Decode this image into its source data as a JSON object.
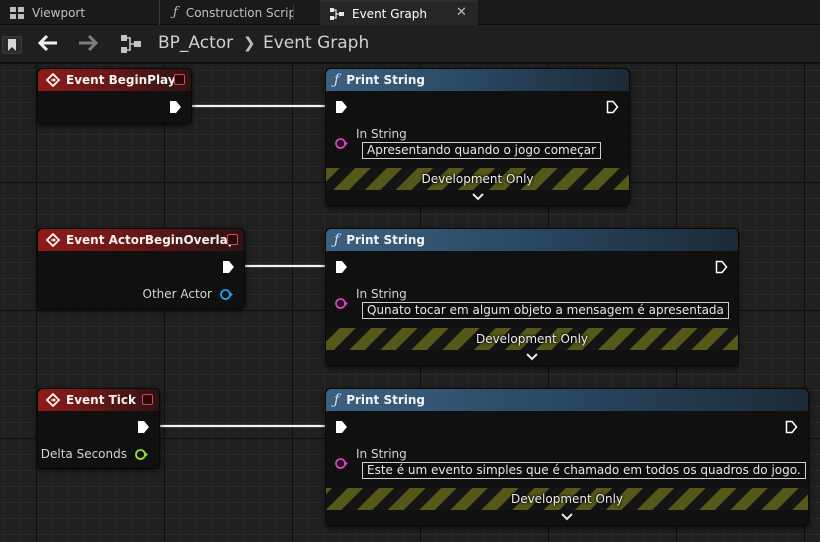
{
  "tabs": [
    {
      "label": "Viewport",
      "icon": "viewport-grid-icon",
      "active": false
    },
    {
      "label": "Construction Scrip",
      "icon": "function-icon",
      "active": false
    },
    {
      "label": "Event Graph",
      "icon": "event-graph-icon",
      "active": true
    }
  ],
  "toolbar": {
    "breadcrumb": {
      "blueprint": "BP_Actor",
      "graph": "Event Graph"
    }
  },
  "nodes": {
    "begin_play": {
      "title": "Event BeginPlay",
      "print": {
        "title": "Print String",
        "in_string_label": "In String",
        "value": "Apresentando quando o jogo começar",
        "dev_only": "Development Only"
      }
    },
    "begin_overlap": {
      "title": "Event ActorBeginOverlap",
      "output_label": "Other Actor",
      "print": {
        "title": "Print String",
        "in_string_label": "In String",
        "value": "Qunato tocar em algum objeto a mensagem é apresentada",
        "dev_only": "Development Only"
      }
    },
    "tick": {
      "title": "Event Tick",
      "output_label": "Delta Seconds",
      "print": {
        "title": "Print String",
        "in_string_label": "In String",
        "value": "Este é um evento simples que é chamado em todos os quadros do jogo.",
        "dev_only": "Development Only"
      }
    }
  },
  "colors": {
    "event_header": "#8e1b1b",
    "function_header": "#3c6180",
    "exec_pin": "#ffffff",
    "string_pin": "#e03ad0",
    "object_pin": "#1fa3e8",
    "float_pin": "#8ee03a",
    "dev_band": "#56581a"
  }
}
